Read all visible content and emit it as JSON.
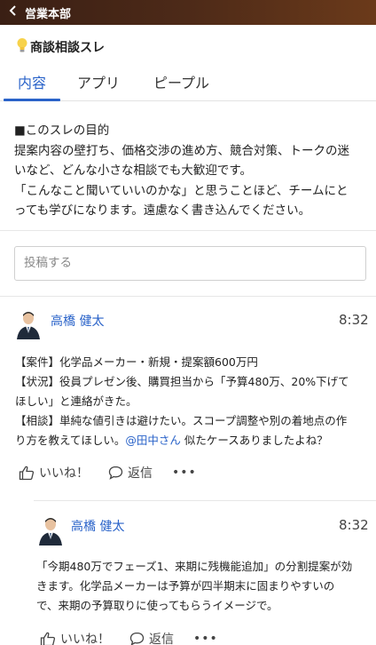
{
  "topbar": {
    "title": "営業本部"
  },
  "thread": {
    "title": "商談相談スレ"
  },
  "tabs": [
    {
      "label": "内容"
    },
    {
      "label": "アプリ"
    },
    {
      "label": "ピープル"
    }
  ],
  "purpose": {
    "heading": "■このスレの目的",
    "line1": "提案内容の壁打ち、価格交渉の進め方、競合対策、トークの迷",
    "line2": "いなど、どんな小さな相談でも大歓迎です。",
    "line3": "「こんなこと聞いていいのかな」と思うことほど、チームにと",
    "line4": "っても学びになります。遠慮なく書き込んでください。"
  },
  "composer": {
    "placeholder": "投稿する"
  },
  "post": {
    "author": "高橋 健太",
    "time": "8:32",
    "line1": "【案件】化学品メーカー・新規・提案額600万円",
    "line2": "【状況】役員プレゼン後、購買担当から「予算480万、20%下げて",
    "line3": "ほしい」と連絡がきた。",
    "line4": "【相談】単純な値引きは避けたい。スコープ調整や別の着地点の作",
    "line5a": "り方を教えてほしい。",
    "mention": "@田中さん",
    "line5b": " 似たケースありましたよね？",
    "like": "いいね！",
    "reply": "返信",
    "more": "•••"
  },
  "reply": {
    "author": "高橋 健太",
    "time": "8:32",
    "line1": "「今期480万でフェーズ1、来期に残機能追加」の分割提案が効",
    "line2": "きます。化学品メーカーは予算が四半期末に固まりやすいの",
    "line3": "で、来期の予算取りに使ってもらうイメージで。",
    "like": "いいね！",
    "reply": "返信",
    "more": "•••"
  },
  "colors": {
    "accent": "#2a63c9",
    "topbar": "#4d2a18"
  },
  "icons": {
    "back": "chevron-left-icon",
    "bulb": "lightbulb-icon",
    "like": "thumbs-up-icon",
    "reply": "speech-bubble-icon",
    "more": "ellipsis-icon"
  }
}
